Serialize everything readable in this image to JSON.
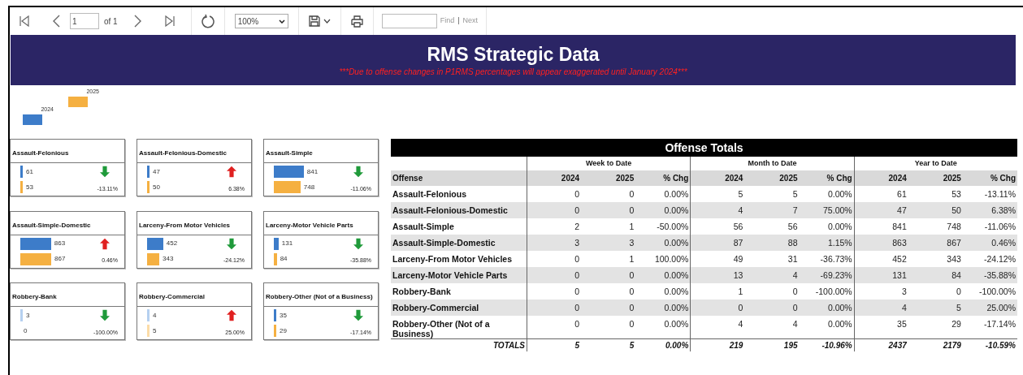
{
  "toolbar": {
    "page": "1",
    "page_count": "of 1",
    "zoom": "100%",
    "find_link": "Find",
    "separator": "|",
    "next_link": "Next"
  },
  "banner": {
    "title": "RMS Strategic Data",
    "notice": "***Due to offense changes in P1RMS percentages will appear exaggerated until January 2024***"
  },
  "legend": [
    {
      "label": "2024",
      "color": "#3d7cc9"
    },
    {
      "label": "2025",
      "color": "#f5b041"
    }
  ],
  "cards": [
    {
      "title": "Assault-Felonious",
      "bars": [
        "61",
        "53"
      ],
      "kind": "down",
      "change": "-13.11%"
    },
    {
      "title": "Assault-Felonious-Domestic",
      "bars": [
        "47",
        "50"
      ],
      "kind": "up",
      "change": "6.38%"
    },
    {
      "title": "Assault-Simple",
      "bars": [
        "841",
        "748"
      ],
      "kind": "down",
      "change": "-11.06%"
    },
    {
      "title": "Assault-Simple-Domestic",
      "bars": [
        "863",
        "867"
      ],
      "kind": "up",
      "change": "0.46%"
    },
    {
      "title": "Larceny-From Motor Vehicles",
      "bars": [
        "452",
        "343"
      ],
      "kind": "down",
      "change": "-24.12%"
    },
    {
      "title": "Larceny-Motor Vehicle Parts",
      "bars": [
        "131",
        "84"
      ],
      "kind": "down",
      "change": "-35.88%"
    },
    {
      "title": "Robbery-Bank",
      "bars": [
        "3",
        "0"
      ],
      "kind": "down",
      "change": "-100.00%"
    },
    {
      "title": "Robbery-Commercial",
      "bars": [
        "4",
        "5"
      ],
      "kind": "up",
      "change": "25.00%"
    },
    {
      "title": "Robbery-Other (Not of a Business)",
      "bars": [
        "35",
        "29"
      ],
      "kind": "down",
      "change": "-17.14%"
    }
  ],
  "table": {
    "title": "Offense Totals",
    "groups": [
      "Week to Date",
      "Month to Date",
      "Year to Date"
    ],
    "columns": [
      "Offense",
      "2024",
      "2025",
      "% Chg",
      "2024",
      "2025",
      "% Chg",
      "2024",
      "2025",
      "% Chg"
    ],
    "rows": [
      {
        "cells": [
          "Assault-Felonious",
          "0",
          "0",
          "0.00%",
          "5",
          "5",
          "0.00%",
          "61",
          "53",
          "-13.11%"
        ],
        "shaded": false
      },
      {
        "cells": [
          "Assault-Felonious-Domestic",
          "0",
          "0",
          "0.00%",
          "4",
          "7",
          "75.00%",
          "47",
          "50",
          "6.38%"
        ],
        "shaded": true
      },
      {
        "cells": [
          "Assault-Simple",
          "2",
          "1",
          "-50.00%",
          "56",
          "56",
          "0.00%",
          "841",
          "748",
          "-11.06%"
        ],
        "shaded": false
      },
      {
        "cells": [
          "Assault-Simple-Domestic",
          "3",
          "3",
          "0.00%",
          "87",
          "88",
          "1.15%",
          "863",
          "867",
          "0.46%"
        ],
        "shaded": true
      },
      {
        "cells": [
          "Larceny-From Motor Vehicles",
          "0",
          "1",
          "100.00%",
          "49",
          "31",
          "-36.73%",
          "452",
          "343",
          "-24.12%"
        ],
        "shaded": false
      },
      {
        "cells": [
          "Larceny-Motor Vehicle Parts",
          "0",
          "0",
          "0.00%",
          "13",
          "4",
          "-69.23%",
          "131",
          "84",
          "-35.88%"
        ],
        "shaded": true
      },
      {
        "cells": [
          "Robbery-Bank",
          "0",
          "0",
          "0.00%",
          "1",
          "0",
          "-100.00%",
          "3",
          "0",
          "-100.00%"
        ],
        "shaded": false
      },
      {
        "cells": [
          "Robbery-Commercial",
          "0",
          "0",
          "0.00%",
          "0",
          "0",
          "0.00%",
          "4",
          "5",
          "25.00%"
        ],
        "shaded": true
      },
      {
        "cells": [
          "Robbery-Other (Not of a Business)",
          "0",
          "0",
          "0.00%",
          "4",
          "4",
          "0.00%",
          "35",
          "29",
          "-17.14%"
        ],
        "shaded": false
      }
    ],
    "totals": [
      "TOTALS",
      "5",
      "5",
      "0.00%",
      "219",
      "195",
      "-10.96%",
      "2437",
      "2179",
      "-10.59%"
    ]
  }
}
